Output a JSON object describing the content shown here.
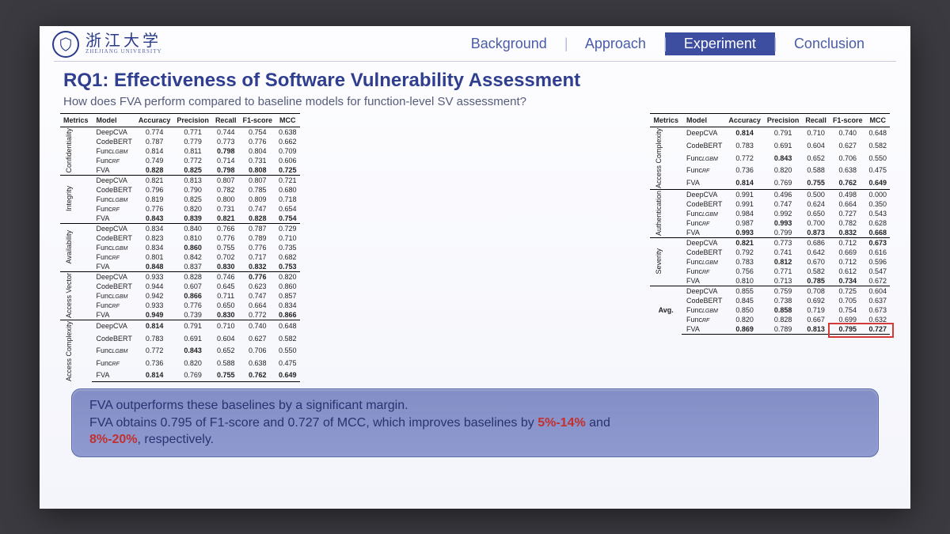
{
  "header": {
    "uni_cn": "浙江大学",
    "uni_en": "ZHEJIANG UNIVERSITY",
    "nav": [
      "Background",
      "Approach",
      "Experiment",
      "Conclusion"
    ],
    "active": "Experiment"
  },
  "title": "RQ1: Effectiveness of Software Vulnerability Assessment",
  "subtitle": "How does FVA perform compared to baseline models for function-level SV assessment?",
  "columns": [
    "Metrics",
    "Model",
    "Accuracy",
    "Precision",
    "Recall",
    "F1-score",
    "MCC"
  ],
  "models": [
    "DeepCVA",
    "CodeBERT",
    "Func_LGBM",
    "Func_RF",
    "FVA"
  ],
  "left_groups": [
    {
      "metric": "Confidentiality",
      "rows": [
        {
          "m": "DeepCVA",
          "v": [
            "0.774",
            "0.771",
            "0.744",
            "0.754",
            "0.638"
          ]
        },
        {
          "m": "CodeBERT",
          "v": [
            "0.787",
            "0.779",
            "0.773",
            "0.776",
            "0.662"
          ]
        },
        {
          "m": "Func_LGBM",
          "v": [
            "0.814",
            "0.811",
            "0.798",
            "0.804",
            "0.709"
          ],
          "b": [
            0,
            0,
            1,
            0,
            0
          ]
        },
        {
          "m": "Func_RF",
          "v": [
            "0.749",
            "0.772",
            "0.714",
            "0.731",
            "0.606"
          ]
        },
        {
          "m": "FVA",
          "v": [
            "0.828",
            "0.825",
            "0.798",
            "0.808",
            "0.725"
          ],
          "b": [
            1,
            1,
            1,
            1,
            1
          ]
        }
      ]
    },
    {
      "metric": "Integrity",
      "rows": [
        {
          "m": "DeepCVA",
          "v": [
            "0.821",
            "0.813",
            "0.807",
            "0.807",
            "0.721"
          ]
        },
        {
          "m": "CodeBERT",
          "v": [
            "0.796",
            "0.790",
            "0.782",
            "0.785",
            "0.680"
          ]
        },
        {
          "m": "Func_LGBM",
          "v": [
            "0.819",
            "0.825",
            "0.800",
            "0.809",
            "0.718"
          ]
        },
        {
          "m": "Func_RF",
          "v": [
            "0.776",
            "0.820",
            "0.731",
            "0.747",
            "0.654"
          ]
        },
        {
          "m": "FVA",
          "v": [
            "0.843",
            "0.839",
            "0.821",
            "0.828",
            "0.754"
          ],
          "b": [
            1,
            1,
            1,
            1,
            1
          ]
        }
      ]
    },
    {
      "metric": "Availability",
      "rows": [
        {
          "m": "DeepCVA",
          "v": [
            "0.834",
            "0.840",
            "0.766",
            "0.787",
            "0.729"
          ]
        },
        {
          "m": "CodeBERT",
          "v": [
            "0.823",
            "0.810",
            "0.776",
            "0.789",
            "0.710"
          ]
        },
        {
          "m": "Func_LGBM",
          "v": [
            "0.834",
            "0.860",
            "0.755",
            "0.776",
            "0.735"
          ],
          "b": [
            0,
            1,
            0,
            0,
            0
          ]
        },
        {
          "m": "Func_RF",
          "v": [
            "0.801",
            "0.842",
            "0.702",
            "0.717",
            "0.682"
          ]
        },
        {
          "m": "FVA",
          "v": [
            "0.848",
            "0.837",
            "0.830",
            "0.832",
            "0.753"
          ],
          "b": [
            1,
            0,
            1,
            1,
            1
          ]
        }
      ]
    },
    {
      "metric": "Access Vector",
      "rows": [
        {
          "m": "DeepCVA",
          "v": [
            "0.933",
            "0.828",
            "0.746",
            "0.776",
            "0.820"
          ],
          "b": [
            0,
            0,
            0,
            1,
            0
          ]
        },
        {
          "m": "CodeBERT",
          "v": [
            "0.944",
            "0.607",
            "0.645",
            "0.623",
            "0.860"
          ]
        },
        {
          "m": "Func_LGBM",
          "v": [
            "0.942",
            "0.866",
            "0.711",
            "0.747",
            "0.857"
          ],
          "b": [
            0,
            1,
            0,
            0,
            0
          ]
        },
        {
          "m": "Func_RF",
          "v": [
            "0.933",
            "0.776",
            "0.650",
            "0.664",
            "0.834"
          ]
        },
        {
          "m": "FVA",
          "v": [
            "0.949",
            "0.739",
            "0.830",
            "0.772",
            "0.866"
          ],
          "b": [
            1,
            0,
            1,
            0,
            1
          ]
        }
      ]
    },
    {
      "metric": "Access Complexity",
      "rows": [
        {
          "m": "DeepCVA",
          "v": [
            "0.814",
            "0.791",
            "0.710",
            "0.740",
            "0.648"
          ],
          "b": [
            1,
            0,
            0,
            0,
            0
          ]
        },
        {
          "m": "CodeBERT",
          "v": [
            "0.783",
            "0.691",
            "0.604",
            "0.627",
            "0.582"
          ]
        },
        {
          "m": "Func_LGBM",
          "v": [
            "0.772",
            "0.843",
            "0.652",
            "0.706",
            "0.550"
          ],
          "b": [
            0,
            1,
            0,
            0,
            0
          ]
        },
        {
          "m": "Func_RF",
          "v": [
            "0.736",
            "0.820",
            "0.588",
            "0.638",
            "0.475"
          ]
        },
        {
          "m": "FVA",
          "v": [
            "0.814",
            "0.769",
            "0.755",
            "0.762",
            "0.649"
          ],
          "b": [
            1,
            0,
            1,
            1,
            1
          ]
        }
      ]
    }
  ],
  "right_groups": [
    {
      "metric": "Access Complexity",
      "rows": [
        {
          "m": "DeepCVA",
          "v": [
            "0.814",
            "0.791",
            "0.710",
            "0.740",
            "0.648"
          ],
          "b": [
            1,
            0,
            0,
            0,
            0
          ]
        },
        {
          "m": "CodeBERT",
          "v": [
            "0.783",
            "0.691",
            "0.604",
            "0.627",
            "0.582"
          ]
        },
        {
          "m": "Func_LGBM",
          "v": [
            "0.772",
            "0.843",
            "0.652",
            "0.706",
            "0.550"
          ],
          "b": [
            0,
            1,
            0,
            0,
            0
          ]
        },
        {
          "m": "Func_RF",
          "v": [
            "0.736",
            "0.820",
            "0.588",
            "0.638",
            "0.475"
          ]
        },
        {
          "m": "FVA",
          "v": [
            "0.814",
            "0.769",
            "0.755",
            "0.762",
            "0.649"
          ],
          "b": [
            1,
            0,
            1,
            1,
            1
          ]
        }
      ]
    },
    {
      "metric": "Authentication",
      "rows": [
        {
          "m": "DeepCVA",
          "v": [
            "0.991",
            "0.496",
            "0.500",
            "0.498",
            "0.000"
          ]
        },
        {
          "m": "CodeBERT",
          "v": [
            "0.991",
            "0.747",
            "0.624",
            "0.664",
            "0.350"
          ]
        },
        {
          "m": "Func_LGBM",
          "v": [
            "0.984",
            "0.992",
            "0.650",
            "0.727",
            "0.543"
          ]
        },
        {
          "m": "Func_RF",
          "v": [
            "0.987",
            "0.993",
            "0.700",
            "0.782",
            "0.628"
          ],
          "b": [
            0,
            1,
            0,
            0,
            0
          ]
        },
        {
          "m": "FVA",
          "v": [
            "0.993",
            "0.799",
            "0.873",
            "0.832",
            "0.668"
          ],
          "b": [
            1,
            0,
            1,
            1,
            1
          ]
        }
      ]
    },
    {
      "metric": "Severity",
      "rows": [
        {
          "m": "DeepCVA",
          "v": [
            "0.821",
            "0.773",
            "0.686",
            "0.712",
            "0.673"
          ],
          "b": [
            1,
            0,
            0,
            0,
            1
          ]
        },
        {
          "m": "CodeBERT",
          "v": [
            "0.792",
            "0.741",
            "0.642",
            "0.669",
            "0.616"
          ]
        },
        {
          "m": "Func_LGBM",
          "v": [
            "0.783",
            "0.812",
            "0.670",
            "0.712",
            "0.596"
          ],
          "b": [
            0,
            1,
            0,
            0,
            0
          ]
        },
        {
          "m": "Func_RF",
          "v": [
            "0.756",
            "0.771",
            "0.582",
            "0.612",
            "0.547"
          ]
        },
        {
          "m": "FVA",
          "v": [
            "0.810",
            "0.713",
            "0.785",
            "0.734",
            "0.672"
          ],
          "b": [
            0,
            0,
            1,
            1,
            0
          ]
        }
      ]
    },
    {
      "metric": "Avg.",
      "rows": [
        {
          "m": "DeepCVA",
          "v": [
            "0.855",
            "0.759",
            "0.708",
            "0.725",
            "0.604"
          ]
        },
        {
          "m": "CodeBERT",
          "v": [
            "0.845",
            "0.738",
            "0.692",
            "0.705",
            "0.637"
          ]
        },
        {
          "m": "Func_LGBM",
          "v": [
            "0.850",
            "0.858",
            "0.719",
            "0.754",
            "0.673"
          ],
          "b": [
            0,
            1,
            0,
            0,
            0
          ]
        },
        {
          "m": "Func_RF",
          "v": [
            "0.820",
            "0.828",
            "0.667",
            "0.699",
            "0.632"
          ]
        },
        {
          "m": "FVA",
          "v": [
            "0.869",
            "0.789",
            "0.813",
            "0.795",
            "0.727"
          ],
          "b": [
            1,
            0,
            1,
            1,
            1
          ]
        }
      ]
    }
  ],
  "callout": {
    "l1": "FVA outperforms these baselines by a significant margin.",
    "l2a": "FVA obtains 0.795 of F1-score and 0.727 of MCC, which improves baselines by ",
    "l2b": "5%-14%",
    "l2c": " and ",
    "l3a": "8%-20%",
    "l3b": ", respectively."
  }
}
